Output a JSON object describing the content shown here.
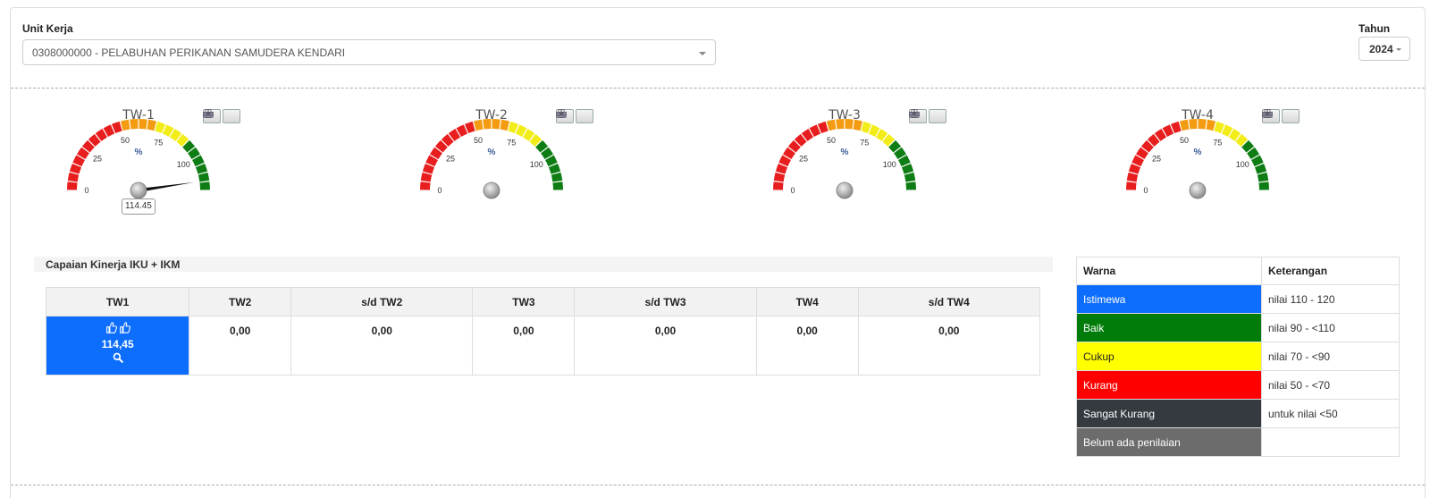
{
  "filters": {
    "unit_label": "Unit Kerja",
    "unit_value": "0308000000 - PELABUHAN PERIKANAN SAMUDERA KENDARI",
    "year_label": "Tahun",
    "year_value": "2024"
  },
  "gauges": [
    {
      "title": "TW-1",
      "value": 114.45,
      "value_label": "114.45"
    },
    {
      "title": "TW-2",
      "value": null,
      "value_label": ""
    },
    {
      "title": "TW-3",
      "value": null,
      "value_label": ""
    },
    {
      "title": "TW-4",
      "value": null,
      "value_label": ""
    }
  ],
  "gauge_scale": {
    "min": 0,
    "max": 120,
    "ticks": [
      "0",
      "25",
      "50",
      "75",
      "100"
    ],
    "unit": "%",
    "bands": [
      {
        "from": 0,
        "to": 50,
        "color": "#e81e1e"
      },
      {
        "from": 50,
        "to": 70,
        "color": "#f39c12"
      },
      {
        "from": 70,
        "to": 90,
        "color": "#f2ec18"
      },
      {
        "from": 90,
        "to": 120,
        "color": "#0e7d14"
      }
    ]
  },
  "performance": {
    "title": "Capaian Kinerja IKU + IKM",
    "headers": [
      "TW1",
      "TW2",
      "s/d TW2",
      "TW3",
      "s/d TW3",
      "TW4",
      "s/d TW4"
    ],
    "tw1_value": "114,45",
    "values": [
      "0,00",
      "0,00",
      "0,00",
      "0,00",
      "0,00",
      "0,00"
    ]
  },
  "legend": {
    "headers": [
      "Warna",
      "Keterangan"
    ],
    "rows": [
      {
        "color_name": "Istimewa",
        "desc": "nilai 110 - 120",
        "bg": "#0d6efd",
        "fg": "#ffffff"
      },
      {
        "color_name": "Baik",
        "desc": "nilai 90 - <110",
        "bg": "#017c0a",
        "fg": "#ffffff"
      },
      {
        "color_name": "Cukup",
        "desc": "nilai 70 - <90",
        "bg": "#ffff00",
        "fg": "#222222"
      },
      {
        "color_name": "Kurang",
        "desc": "nilai 50 - <70",
        "bg": "#ff0000",
        "fg": "#ffffff"
      },
      {
        "color_name": "Sangat Kurang",
        "desc": "untuk nilai <50",
        "bg": "#343a40",
        "fg": "#ffffff"
      },
      {
        "color_name": "Belum ada penilaian",
        "desc": "",
        "bg": "#6c6c6c",
        "fg": "#ffffff"
      }
    ]
  }
}
